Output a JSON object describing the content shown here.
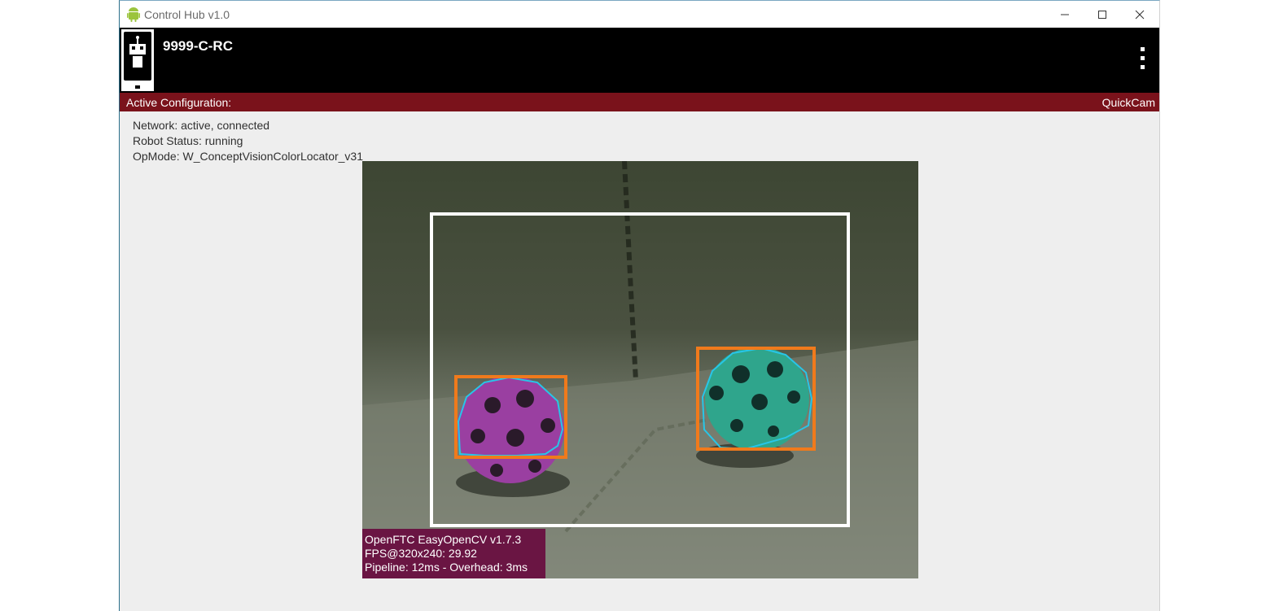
{
  "window": {
    "title": "Control Hub v1.0",
    "controls": [
      "minimize",
      "maximize",
      "close"
    ]
  },
  "appbar": {
    "robot_name": "9999-C-RC",
    "menu_icon": "more-vert-icon"
  },
  "config_bar": {
    "label": "Active Configuration:",
    "value": "QuickCam"
  },
  "status": {
    "network": "Network: active, connected",
    "robot_status": "Robot Status: running",
    "opmode": "OpMode: W_ConceptVisionColorLocator_v31"
  },
  "camera": {
    "overlay_lines": [
      "OpenFTC EasyOpenCV v1.7.3",
      "FPS@320x240: 29.92",
      "Pipeline: 12ms - Overhead: 3ms"
    ],
    "colors": {
      "roi_box": "#ffffff",
      "blob_box": "#f07a1c",
      "contour": "#27c6e8",
      "purple_ball": "#9a3fa1",
      "teal_ball": "#2fa58c"
    }
  },
  "colors": {
    "appbar": "#000000",
    "config_bar": "#7a121b",
    "overlay": "#6a1543"
  }
}
